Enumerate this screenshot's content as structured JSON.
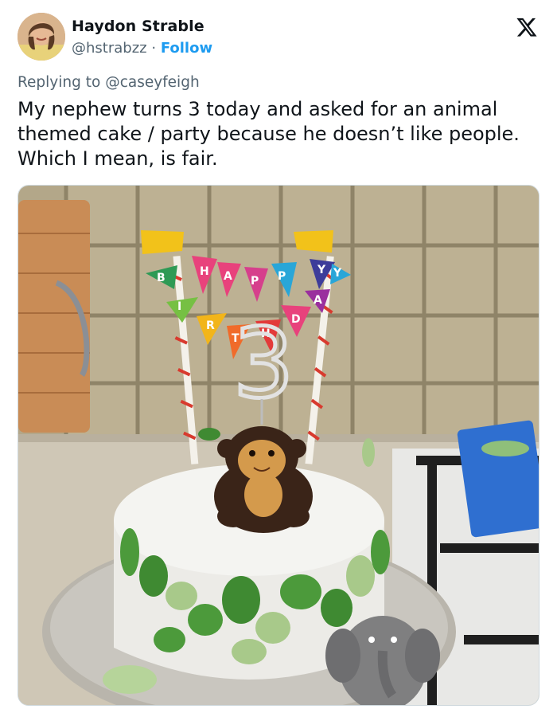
{
  "author": {
    "name": "Haydon Strable",
    "handle": "@hstrabzz",
    "separator": "·",
    "follow_label": "Follow",
    "avatar_icon": "profile-photo-avatar"
  },
  "platform": {
    "logo_icon": "x-logo-icon"
  },
  "reply": {
    "prefix": "Replying to ",
    "mention": "@caseyfeigh"
  },
  "tweet": {
    "text": "My nephew turns 3 today and asked for an animal themed cake / party because he doesn’t like people. Which I mean, is fair."
  },
  "photo": {
    "banner_letters": [
      "B",
      "I",
      "R",
      "T",
      "H",
      "D",
      "A",
      "Y",
      "H",
      "A",
      "P",
      "P",
      "Y"
    ],
    "number_topper": "3",
    "colors": {
      "tile": "#b9ad8f",
      "grout": "#9a8f74",
      "fondant": "#ededea",
      "leaf_dark": "#4c9a3b",
      "leaf_light": "#a8c98a"
    }
  }
}
